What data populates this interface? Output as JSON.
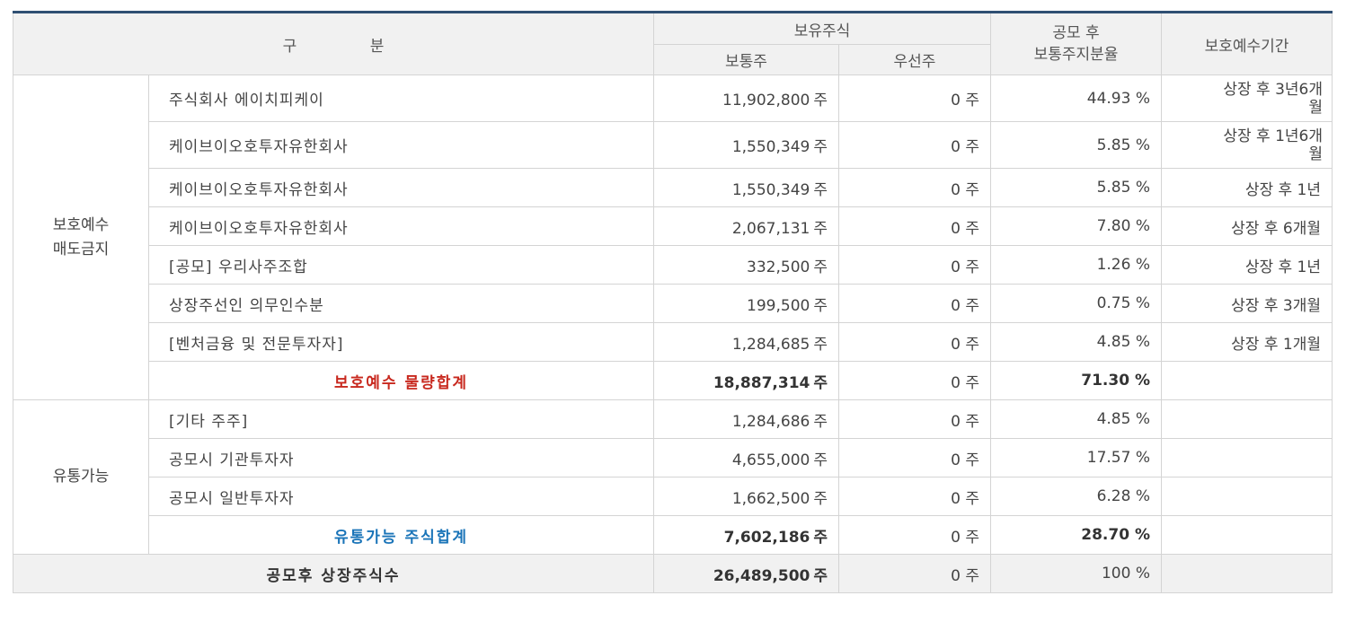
{
  "header": {
    "category": "구 분",
    "holdings": "보유주식",
    "common": "보통주",
    "preferred": "우선주",
    "ratio_line1": "공모 후",
    "ratio_line2": "보통주지분율",
    "period": "보호예수기간"
  },
  "groups": {
    "lockup_line1": "보호예수",
    "lockup_line2": "매도금지",
    "tradable": "유통가능"
  },
  "rows": [
    {
      "name": "주식회사 에이치피케이",
      "common": "11,902,800",
      "unit": "주",
      "preferred": "0 주",
      "ratio": "44.93 %",
      "period_l1": "상장 후 3년6개",
      "period_l2": "월"
    },
    {
      "name": "케이브이오호투자유한회사",
      "common": "1,550,349",
      "unit": "주",
      "preferred": "0 주",
      "ratio": "5.85 %",
      "period_l1": "상장 후 1년6개",
      "period_l2": "월"
    },
    {
      "name": "케이브이오호투자유한회사",
      "common": "1,550,349",
      "unit": "주",
      "preferred": "0 주",
      "ratio": "5.85 %",
      "period_l1": "상장 후 1년",
      "period_l2": ""
    },
    {
      "name": "케이브이오호투자유한회사",
      "common": "2,067,131",
      "unit": "주",
      "preferred": "0 주",
      "ratio": "7.80 %",
      "period_l1": "상장 후 6개월",
      "period_l2": ""
    },
    {
      "name": "[공모] 우리사주조합",
      "common": "332,500",
      "unit": "주",
      "preferred": "0 주",
      "ratio": "1.26 %",
      "period_l1": "상장 후 1년",
      "period_l2": ""
    },
    {
      "name": "상장주선인 의무인수분",
      "common": "199,500",
      "unit": "주",
      "preferred": "0 주",
      "ratio": "0.75 %",
      "period_l1": "상장 후 3개월",
      "period_l2": ""
    },
    {
      "name": "[벤처금융 및 전문투자자]",
      "common": "1,284,685",
      "unit": "주",
      "preferred": "0 주",
      "ratio": "4.85 %",
      "period_l1": "상장 후 1개월",
      "period_l2": ""
    }
  ],
  "lockup_total": {
    "label": "보호예수 물량합계",
    "common": "18,887,314",
    "unit": "주",
    "preferred": "0 주",
    "ratio": "71.30 %"
  },
  "tradable_rows": [
    {
      "name": "[기타 주주]",
      "common": "1,284,686",
      "unit": "주",
      "preferred": "0 주",
      "ratio": "4.85 %"
    },
    {
      "name": "공모시 기관투자자",
      "common": "4,655,000",
      "unit": "주",
      "preferred": "0 주",
      "ratio": "17.57 %"
    },
    {
      "name": "공모시 일반투자자",
      "common": "1,662,500",
      "unit": "주",
      "preferred": "0 주",
      "ratio": "6.28 %"
    }
  ],
  "tradable_total": {
    "label": "유통가능 주식합계",
    "common": "7,602,186",
    "unit": "주",
    "preferred": "0 주",
    "ratio": "28.70 %"
  },
  "grand_total": {
    "label": "공모후 상장주식수",
    "common": "26,489,500",
    "unit": "주",
    "preferred": "0 주",
    "ratio": "100 %"
  },
  "colors": {
    "header_bg": "#f1f1f1",
    "top_border": "#2f4f73",
    "subtotal_red": "#c8281e",
    "subtotal_blue": "#1a74b8",
    "grid": "#d4d4d4"
  }
}
